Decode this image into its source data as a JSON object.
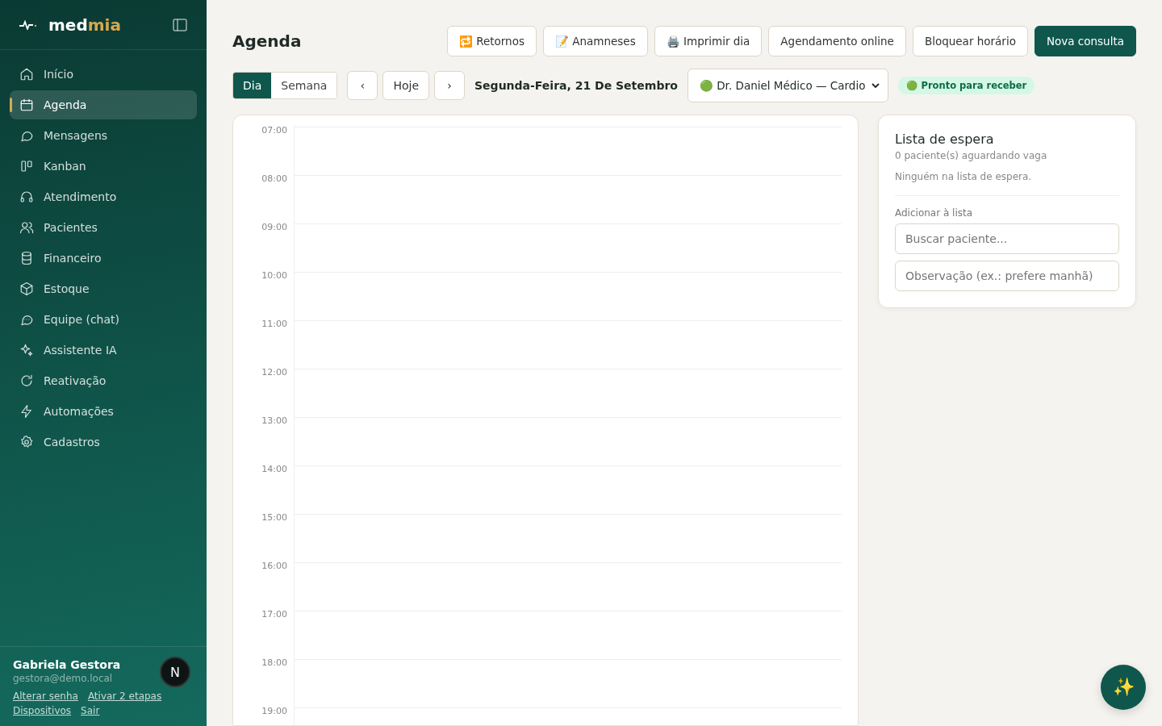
{
  "sidebar": {
    "logo": {
      "part_1": "med",
      "part_2": "mia"
    },
    "items": [
      {
        "label": "Início",
        "selected": false
      },
      {
        "label": "Agenda",
        "selected": true
      },
      {
        "label": "Mensagens",
        "selected": false
      },
      {
        "label": "Kanban",
        "selected": false
      },
      {
        "label": "Atendimento",
        "selected": false
      },
      {
        "label": "Pacientes",
        "selected": false
      },
      {
        "label": "Financeiro",
        "selected": false
      },
      {
        "label": "Estoque",
        "selected": false
      },
      {
        "label": "Equipe (chat)",
        "selected": false
      },
      {
        "label": "Assistente IA",
        "selected": false
      },
      {
        "label": "Reativação",
        "selected": false
      },
      {
        "label": "Automações",
        "selected": false
      },
      {
        "label": "Cadastros",
        "selected": false
      }
    ],
    "user": {
      "name": "Gabriela Gestora",
      "email": "gestora@demo.local",
      "links": [
        "Alterar senha",
        "Ativar 2 etapas",
        "Dispositivos",
        "Sair"
      ]
    },
    "dev_badge": "N"
  },
  "header": {
    "title": "Agenda",
    "buttons": [
      {
        "label": "🔁 Retornos",
        "kind": "outline"
      },
      {
        "label": "📝 Anamneses",
        "kind": "outline"
      },
      {
        "label": "🖨️ Imprimir dia",
        "kind": "outline"
      },
      {
        "label": "Agendamento online",
        "kind": "outline"
      },
      {
        "label": "Bloquear horário",
        "kind": "outline"
      },
      {
        "label": "Nova consulta",
        "kind": "primary"
      }
    ]
  },
  "toolbar": {
    "views": [
      {
        "label": "Dia",
        "selected": true
      },
      {
        "label": "Semana",
        "selected": false
      }
    ],
    "prev": "‹",
    "today": "Hoje",
    "next": "›",
    "date": "Segunda-Feira, 21 De Setembro",
    "doctor": "🟢 Dr. Daniel Médico — Cardio",
    "status": "🟢 Pronto para receber"
  },
  "calendar": {
    "hours": [
      "07:00",
      "08:00",
      "09:00",
      "10:00",
      "11:00",
      "12:00",
      "13:00",
      "14:00",
      "15:00",
      "16:00",
      "17:00",
      "18:00",
      "19:00"
    ]
  },
  "waitlist": {
    "title": "Lista de espera",
    "count": "0 paciente(s) aguardando vaga",
    "empty": "Ninguém na lista de espera.",
    "add_label": "Adicionar à lista",
    "search": {
      "placeholder": "Buscar paciente..."
    },
    "note": {
      "placeholder": "Observação (ex.: prefere manhã)"
    }
  },
  "fab": "✨"
}
